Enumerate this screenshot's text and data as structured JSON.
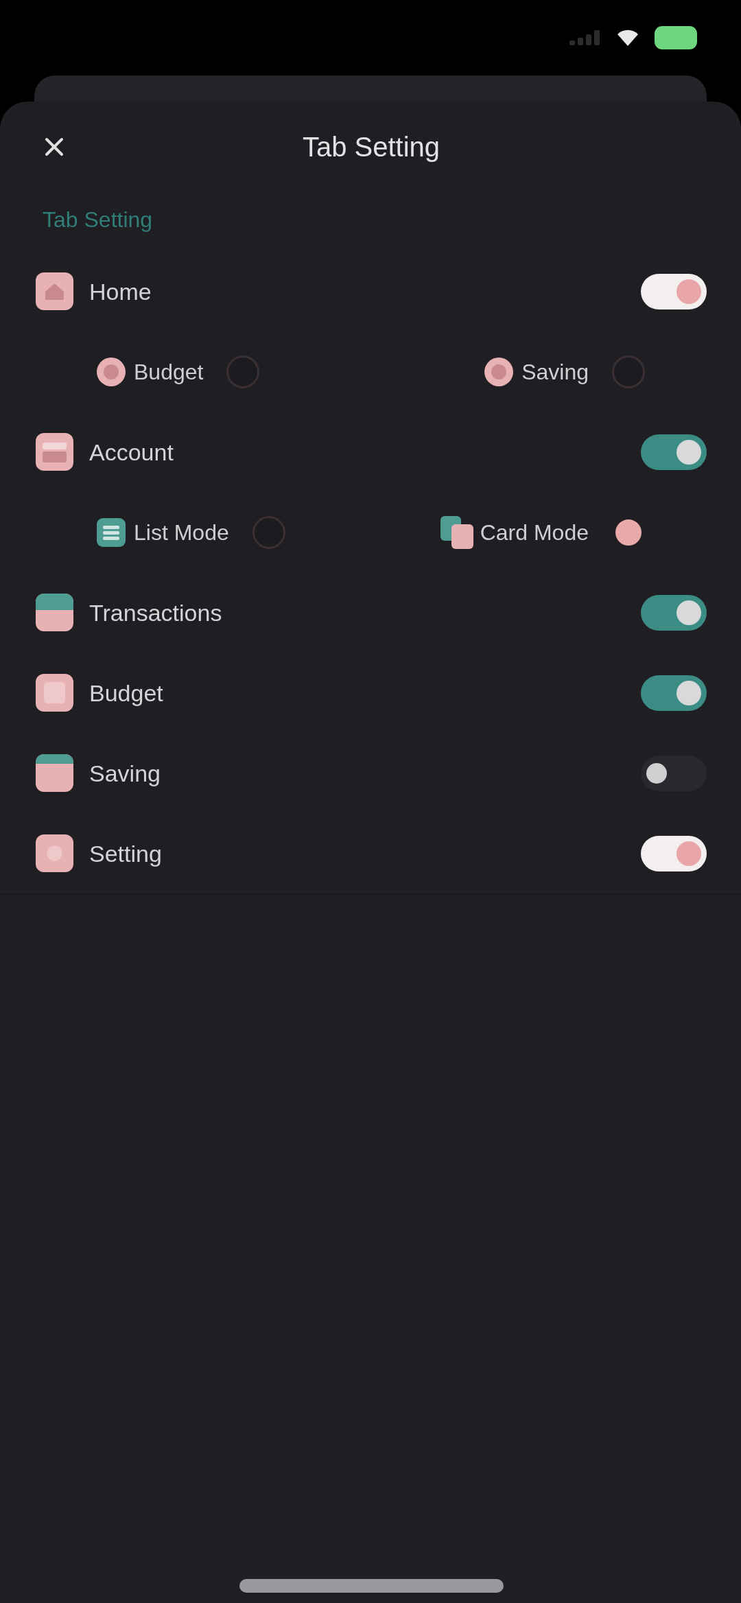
{
  "sheet": {
    "title": "Tab Setting",
    "section_label": "Tab Setting"
  },
  "tabs": [
    {
      "label": "Home",
      "on": true,
      "locked": true,
      "options": [
        {
          "label": "Budget",
          "selected": false
        },
        {
          "label": "Saving",
          "selected": false
        }
      ]
    },
    {
      "label": "Account",
      "on": true,
      "locked": false,
      "options": [
        {
          "label": "List Mode",
          "selected": false
        },
        {
          "label": "Card Mode",
          "selected": true
        }
      ]
    },
    {
      "label": "Transactions",
      "on": true,
      "locked": false
    },
    {
      "label": "Budget",
      "on": true,
      "locked": false
    },
    {
      "label": "Saving",
      "on": false,
      "locked": false
    },
    {
      "label": "Setting",
      "on": true,
      "locked": true
    }
  ]
}
